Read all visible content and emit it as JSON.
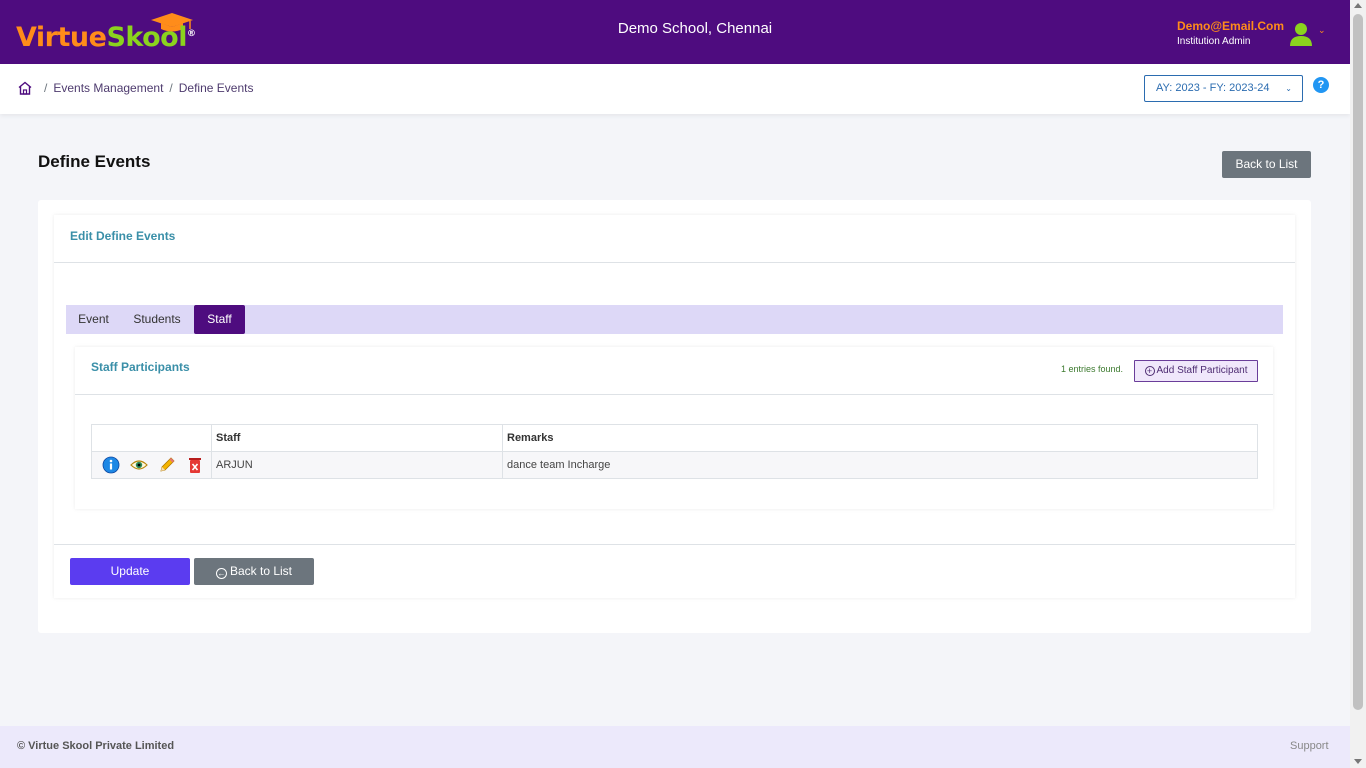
{
  "header": {
    "logo": {
      "part1": "Virtue",
      "part2": "Skool",
      "reg": "®"
    },
    "school_name": "Demo School, Chennai",
    "user_email": "Demo@Email.Com",
    "user_role": "Institution Admin",
    "caret": "⌄"
  },
  "breadcrumb": {
    "separator": "/",
    "items": [
      "Events Management",
      "Define Events"
    ]
  },
  "ay_select": {
    "value": "AY: 2023 - FY: 2023-24",
    "caret": "⌄"
  },
  "help": "?",
  "page": {
    "title": "Define Events",
    "back_label": "Back to List"
  },
  "card": {
    "title": "Edit Define Events",
    "tabs": [
      {
        "label": "Event",
        "active": false
      },
      {
        "label": "Students",
        "active": false
      },
      {
        "label": "Staff",
        "active": true
      }
    ]
  },
  "staff_panel": {
    "title": "Staff Participants",
    "entries": "1 entries found.",
    "add_label": "Add Staff Participant",
    "columns": [
      "",
      "Staff",
      "Remarks"
    ],
    "rows": [
      {
        "staff": "ARJUN",
        "remarks": "dance team Incharge"
      }
    ]
  },
  "actions": {
    "update_label": "Update",
    "back_label": "Back to List"
  },
  "footer": {
    "copyright": "© Virtue Skool Private Limited",
    "support": "Support"
  },
  "colors": {
    "header_bg": "#4e0c7f",
    "brand_orange": "#ff8c1a",
    "brand_green": "#8bd31e",
    "primary_button": "#5b3cf0",
    "secondary_button": "#6c757d",
    "section_title": "#3a8fa8",
    "tab_strip": "#ddd8f7"
  }
}
